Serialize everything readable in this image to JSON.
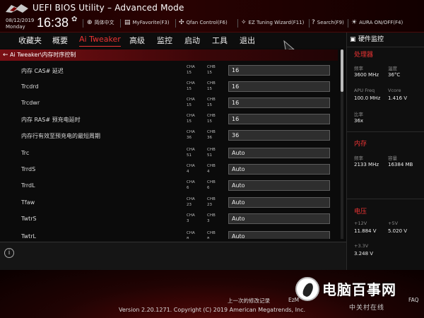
{
  "header": {
    "title": "UEFI BIOS Utility – Advanced Mode",
    "date": "08/12/2019",
    "weekday": "Monday",
    "time": "16:38",
    "language": "简体中文",
    "my_favorite": "MyFavorite(F3)",
    "qfan": "Qfan Control(F6)",
    "ez_tuning": "EZ Tuning Wizard(F11)",
    "search": "Search(F9)",
    "aura": "AURA ON/OFF(F4)"
  },
  "menu": {
    "items": [
      "收藏夹",
      "概要",
      "Ai Tweaker",
      "高级",
      "监控",
      "启动",
      "工具",
      "退出"
    ],
    "active": "Ai Tweaker"
  },
  "breadcrumb": "Ai Tweaker\\内存时序控制",
  "settings": [
    {
      "label": "内存 CAS# 延迟",
      "cha_label": "CHA",
      "cha": "15",
      "chb_label": "CHB",
      "chb": "15",
      "value": "16"
    },
    {
      "label": "Trcdrd",
      "cha_label": "CHA",
      "cha": "15",
      "chb_label": "CHB",
      "chb": "15",
      "value": "16"
    },
    {
      "label": "Trcdwr",
      "cha_label": "CHA",
      "cha": "15",
      "chb_label": "CHB",
      "chb": "15",
      "value": "16"
    },
    {
      "label": "内存 RAS# 预充电延时",
      "cha_label": "CHA",
      "cha": "15",
      "chb_label": "CHB",
      "chb": "15",
      "value": "16"
    },
    {
      "label": "内存行有效至预充电的最短周期",
      "cha_label": "CHA",
      "cha": "36",
      "chb_label": "CHB",
      "chb": "36",
      "value": "36"
    },
    {
      "label": "Trc",
      "cha_label": "CHA",
      "cha": "51",
      "chb_label": "CHB",
      "chb": "51",
      "value": "Auto"
    },
    {
      "label": "TrrdS",
      "cha_label": "CHA",
      "cha": "4",
      "chb_label": "CHB",
      "chb": "4",
      "value": "Auto"
    },
    {
      "label": "TrrdL",
      "cha_label": "CHA",
      "cha": "6",
      "chb_label": "CHB",
      "chb": "6",
      "value": "Auto"
    },
    {
      "label": "Tfaw",
      "cha_label": "CHA",
      "cha": "23",
      "chb_label": "CHB",
      "chb": "23",
      "value": "Auto"
    },
    {
      "label": "TwtrS",
      "cha_label": "CHA",
      "cha": "3",
      "chb_label": "CHB",
      "chb": "3",
      "value": "Auto"
    },
    {
      "label": "TwtrL",
      "cha_label": "CHA",
      "cha": "8",
      "chb_label": "CHB",
      "chb": "8",
      "value": "Auto"
    }
  ],
  "side": {
    "title": "硬件监控",
    "cpu": {
      "title": "处理器",
      "freq_label": "频率",
      "freq": "3600 MHz",
      "temp_label": "温度",
      "temp": "36°C",
      "apu_label": "APU Freq",
      "apu": "100.0 MHz",
      "vcore_label": "Vcore",
      "vcore": "1.416 V",
      "ratio_label": "比率",
      "ratio": "36x"
    },
    "memory": {
      "title": "内存",
      "freq_label": "频率",
      "freq": "2133 MHz",
      "cap_label": "容量",
      "cap": "16384 MB"
    },
    "voltage": {
      "title": "电压",
      "v12_label": "+12V",
      "v12": "11.884 V",
      "v5_label": "+5V",
      "v5": "5.020 V",
      "v33_label": "+3.3V",
      "v33": "3.248 V"
    }
  },
  "footer": {
    "last_change": "上一次的修改记录",
    "ezmode": "EzM",
    "faq": "FAQ",
    "copyright": "Version 2.20.1271. Copyright (C) 2019 American Megatrends, Inc.",
    "watermark": "电脑百事网",
    "watermark_sub": "中关村在线"
  }
}
